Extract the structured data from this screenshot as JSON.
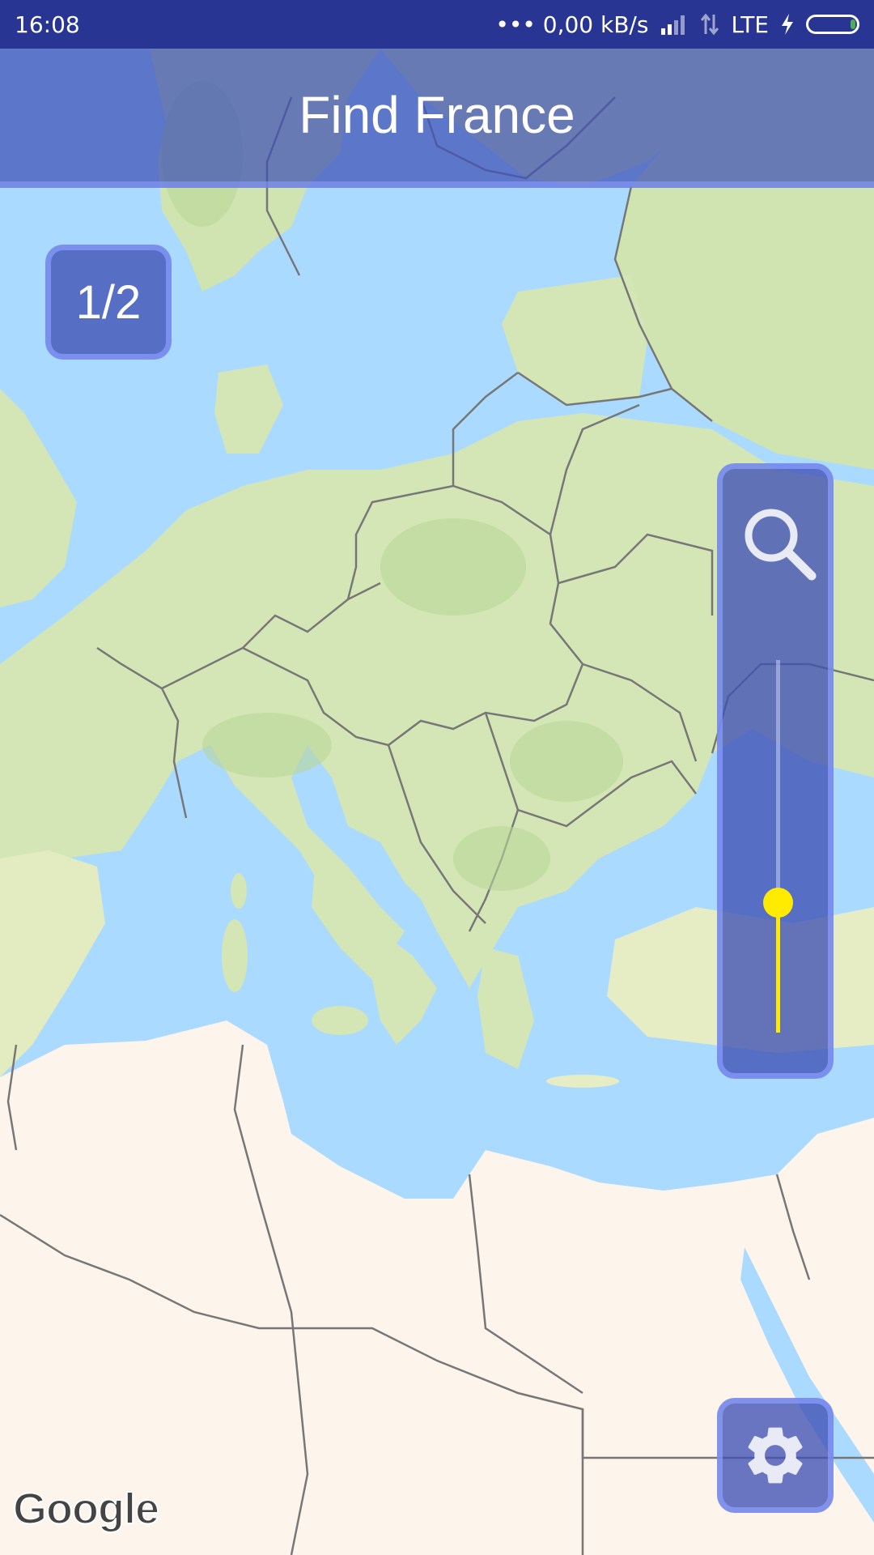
{
  "status_bar": {
    "time": "16:08",
    "net_speed": "••• 0,00 kB/s",
    "network": "LTE",
    "icons": [
      "signal-icon",
      "data-arrows-icon",
      "charging-icon",
      "battery-icon"
    ]
  },
  "header": {
    "title": "Find France"
  },
  "counter": {
    "text": "1/2"
  },
  "zoom": {
    "icon": "search-icon",
    "level_fraction": 0.35,
    "accent_color": "#ffeb00"
  },
  "settings": {
    "icon": "gear-icon"
  },
  "map": {
    "attribution": "Google",
    "colors": {
      "water": "#aadaff",
      "land": "#d4e6b5",
      "desert": "#fdf4ec",
      "border": "#777777"
    }
  },
  "theme": {
    "primary": "#3f51b5",
    "primary_dark": "#283593",
    "primary_light": "#8c9eff"
  }
}
